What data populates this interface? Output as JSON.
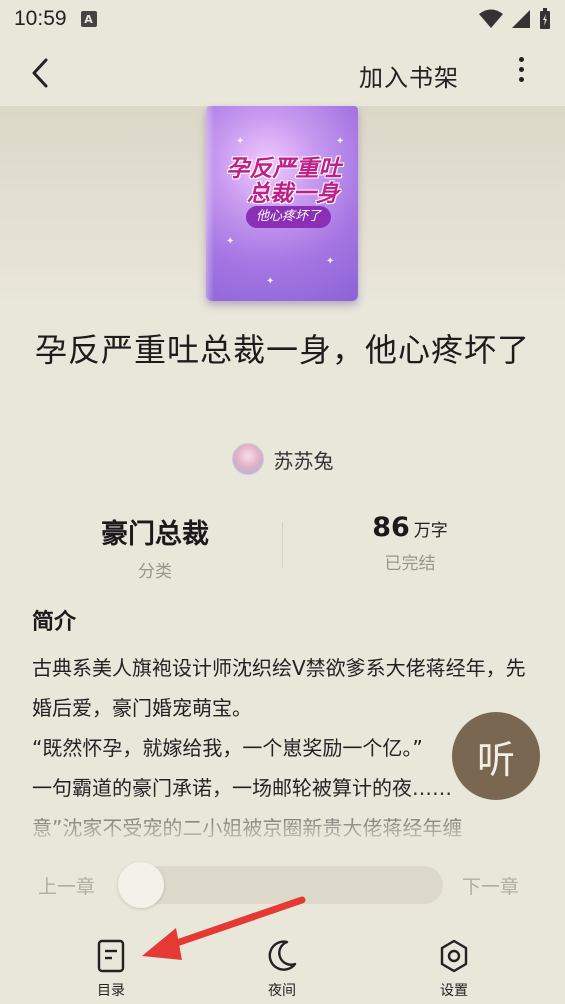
{
  "status_bar": {
    "time": "10:59",
    "notification_icon": "A"
  },
  "header": {
    "add_to_shelf": "加入书架"
  },
  "cover": {
    "title_line1": "孕反严重吐",
    "title_line2": "总裁一身",
    "subtitle": "他心疼坏了"
  },
  "book": {
    "title": "孕反严重吐总裁一身，他心疼坏了",
    "author": "苏苏兔"
  },
  "stats": {
    "category_value": "豪门总裁",
    "category_label": "分类",
    "word_count": "86",
    "word_unit": "万字",
    "status_label": "已完结"
  },
  "intro": {
    "heading": "简介",
    "text": "古典系美人旗袍设计师沈织绘V禁欲爹系大佬蒋经年，先婚后爱，豪门婚宠萌宝。\n“既然怀孕，就嫁给我，一个崽奖励一个亿。”\n一句霸道的豪门承诺，一场邮轮被算计的夜……\n意”沈家不受宠的二小姐被京圈新贵大佬蒋经年缠"
  },
  "listen": {
    "label": "听"
  },
  "chapter_nav": {
    "prev": "上一章",
    "next": "下一章"
  },
  "bottom_nav": {
    "toc": "目录",
    "night": "夜间",
    "settings": "设置"
  },
  "colors": {
    "background": "#e9e6da",
    "listen_button": "#7a6752",
    "arrow": "#e53935"
  }
}
